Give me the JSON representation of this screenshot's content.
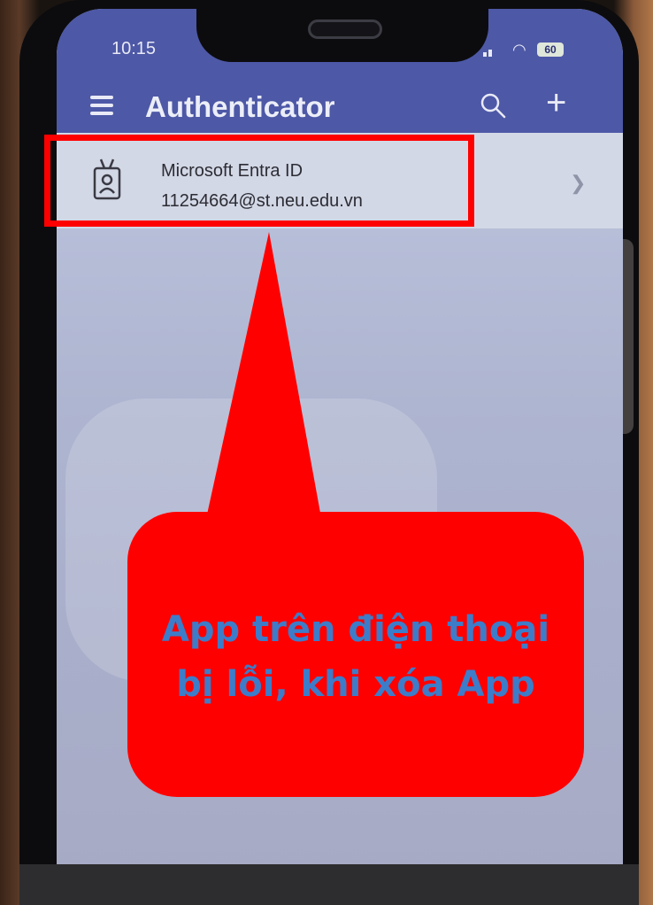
{
  "status_bar": {
    "time": "10:15",
    "battery": "60",
    "signal_icon": "signal-bars-icon",
    "wifi_icon": "wifi-icon",
    "background_color": "#4d58a6"
  },
  "app_bar": {
    "title": "Authenticator",
    "menu_icon": "hamburger-menu-icon",
    "search_icon": "search-icon",
    "add_icon": "plus-icon"
  },
  "accounts": [
    {
      "name": "Microsoft Entra ID",
      "email": "11254664@st.neu.edu.vn",
      "icon": "id-badge-icon"
    }
  ],
  "annotation": {
    "text": "App trên điện thoại bị lỗi, khi xóa App",
    "box_color": "#ff0000",
    "text_color": "#3d7cc9"
  }
}
